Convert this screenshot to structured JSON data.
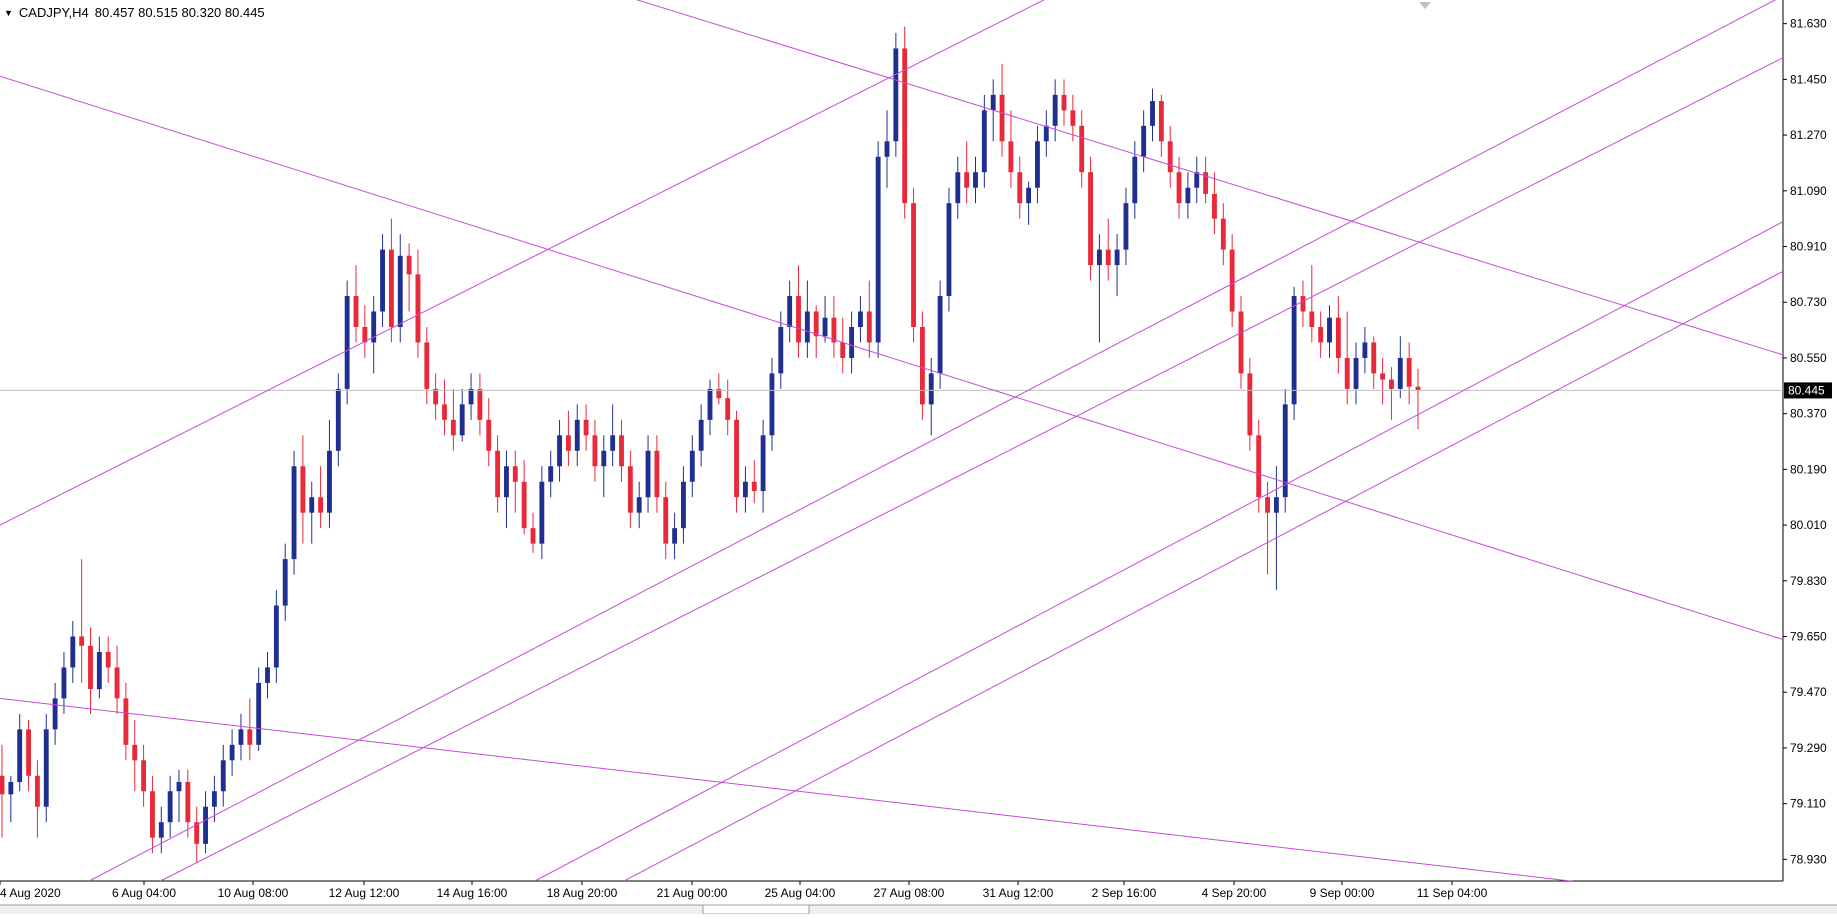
{
  "header": {
    "symbol_tf": "CADJPY,H4",
    "ohlc": "80.457 80.515 80.320 80.445"
  },
  "chart_data": {
    "type": "candlestick",
    "symbol": "CADJPY",
    "timeframe": "H4",
    "y_ticks": [
      "81.630",
      "81.450",
      "81.270",
      "81.090",
      "80.910",
      "80.730",
      "80.550",
      "80.370",
      "80.190",
      "80.010",
      "79.830",
      "79.650",
      "79.470",
      "79.290",
      "79.110",
      "78.930"
    ],
    "ylim": [
      78.86,
      81.7
    ],
    "x_ticks": [
      "4 Aug 2020",
      "6 Aug 04:00",
      "10 Aug 08:00",
      "12 Aug 12:00",
      "14 Aug 16:00",
      "18 Aug 20:00",
      "21 Aug 00:00",
      "25 Aug 04:00",
      "27 Aug 08:00",
      "31 Aug 12:00",
      "2 Sep 16:00",
      "4 Sep 20:00",
      "9 Sep 00:00",
      "11 Sep 04:00"
    ],
    "current_price": "80.445",
    "colors": {
      "bull": "#1f2f8f",
      "bear": "#e8293a",
      "trendline": "#c74bd9",
      "price_line": "#c0c0c0",
      "price_label_bg": "#000000"
    },
    "candles": [
      [
        79.2,
        79.3,
        79.0,
        79.14
      ],
      [
        79.14,
        79.2,
        79.05,
        79.18
      ],
      [
        79.18,
        79.4,
        79.15,
        79.35
      ],
      [
        79.35,
        79.38,
        79.15,
        79.2
      ],
      [
        79.2,
        79.25,
        79.0,
        79.1
      ],
      [
        79.1,
        79.4,
        79.05,
        79.35
      ],
      [
        79.35,
        79.5,
        79.3,
        79.45
      ],
      [
        79.45,
        79.6,
        79.4,
        79.55
      ],
      [
        79.55,
        79.7,
        79.5,
        79.65
      ],
      [
        79.65,
        79.9,
        79.5,
        79.62
      ],
      [
        79.62,
        79.68,
        79.4,
        79.48
      ],
      [
        79.48,
        79.65,
        79.45,
        79.6
      ],
      [
        79.6,
        79.65,
        79.5,
        79.55
      ],
      [
        79.55,
        79.62,
        79.4,
        79.45
      ],
      [
        79.45,
        79.5,
        79.25,
        79.3
      ],
      [
        79.3,
        79.38,
        79.15,
        79.25
      ],
      [
        79.25,
        79.3,
        79.1,
        79.15
      ],
      [
        79.15,
        79.2,
        78.95,
        79.0
      ],
      [
        79.0,
        79.1,
        78.95,
        79.05
      ],
      [
        79.05,
        79.2,
        79.0,
        79.15
      ],
      [
        79.15,
        79.22,
        79.05,
        79.18
      ],
      [
        79.18,
        79.22,
        79.0,
        79.05
      ],
      [
        79.05,
        79.1,
        78.92,
        78.98
      ],
      [
        78.98,
        79.15,
        78.95,
        79.1
      ],
      [
        79.1,
        79.2,
        79.05,
        79.15
      ],
      [
        79.15,
        79.3,
        79.1,
        79.25
      ],
      [
        79.25,
        79.35,
        79.2,
        79.3
      ],
      [
        79.3,
        79.4,
        79.25,
        79.35
      ],
      [
        79.35,
        79.45,
        79.25,
        79.3
      ],
      [
        79.3,
        79.55,
        79.28,
        79.5
      ],
      [
        79.5,
        79.6,
        79.45,
        79.55
      ],
      [
        79.55,
        79.8,
        79.5,
        79.75
      ],
      [
        79.75,
        79.95,
        79.7,
        79.9
      ],
      [
        79.9,
        80.25,
        79.85,
        80.2
      ],
      [
        80.2,
        80.3,
        79.95,
        80.05
      ],
      [
        80.05,
        80.15,
        79.95,
        80.1
      ],
      [
        80.1,
        80.2,
        80.0,
        80.05
      ],
      [
        80.05,
        80.35,
        80.0,
        80.25
      ],
      [
        80.25,
        80.5,
        80.2,
        80.45
      ],
      [
        80.45,
        80.8,
        80.4,
        80.75
      ],
      [
        80.75,
        80.85,
        80.6,
        80.65
      ],
      [
        80.65,
        80.72,
        80.55,
        80.6
      ],
      [
        80.6,
        80.75,
        80.5,
        80.7
      ],
      [
        80.7,
        80.95,
        80.65,
        80.9
      ],
      [
        80.9,
        81.0,
        80.6,
        80.65
      ],
      [
        80.65,
        80.95,
        80.6,
        80.88
      ],
      [
        80.88,
        80.92,
        80.7,
        80.82
      ],
      [
        80.82,
        80.9,
        80.55,
        80.6
      ],
      [
        80.6,
        80.65,
        80.4,
        80.45
      ],
      [
        80.45,
        80.5,
        80.35,
        80.4
      ],
      [
        80.4,
        80.48,
        80.3,
        80.35
      ],
      [
        80.35,
        80.45,
        80.25,
        80.3
      ],
      [
        80.3,
        80.45,
        80.28,
        80.4
      ],
      [
        80.4,
        80.5,
        80.35,
        80.45
      ],
      [
        80.45,
        80.5,
        80.3,
        80.35
      ],
      [
        80.35,
        80.42,
        80.2,
        80.25
      ],
      [
        80.25,
        80.3,
        80.05,
        80.1
      ],
      [
        80.1,
        80.25,
        80.0,
        80.2
      ],
      [
        80.2,
        80.25,
        80.05,
        80.15
      ],
      [
        80.15,
        80.22,
        79.98,
        80.0
      ],
      [
        80.0,
        80.05,
        79.92,
        79.95
      ],
      [
        79.95,
        80.2,
        79.9,
        80.15
      ],
      [
        80.15,
        80.25,
        80.1,
        80.2
      ],
      [
        80.2,
        80.35,
        80.15,
        80.3
      ],
      [
        80.3,
        80.38,
        80.2,
        80.25
      ],
      [
        80.25,
        80.4,
        80.2,
        80.35
      ],
      [
        80.35,
        80.4,
        80.25,
        80.3
      ],
      [
        80.3,
        80.35,
        80.15,
        80.2
      ],
      [
        80.2,
        80.3,
        80.1,
        80.25
      ],
      [
        80.25,
        80.4,
        80.2,
        80.3
      ],
      [
        80.3,
        80.35,
        80.15,
        80.2
      ],
      [
        80.2,
        80.25,
        80.0,
        80.05
      ],
      [
        80.05,
        80.15,
        80.0,
        80.1
      ],
      [
        80.1,
        80.3,
        80.05,
        80.25
      ],
      [
        80.25,
        80.3,
        80.05,
        80.1
      ],
      [
        80.1,
        80.15,
        79.9,
        79.95
      ],
      [
        79.95,
        80.05,
        79.9,
        80.0
      ],
      [
        80.0,
        80.2,
        79.95,
        80.15
      ],
      [
        80.15,
        80.3,
        80.1,
        80.25
      ],
      [
        80.25,
        80.4,
        80.2,
        80.35
      ],
      [
        80.35,
        80.48,
        80.3,
        80.45
      ],
      [
        80.45,
        80.5,
        80.4,
        80.42
      ],
      [
        80.42,
        80.48,
        80.3,
        80.35
      ],
      [
        80.35,
        80.38,
        80.05,
        80.1
      ],
      [
        80.1,
        80.2,
        80.05,
        80.15
      ],
      [
        80.15,
        80.22,
        80.08,
        80.12
      ],
      [
        80.12,
        80.35,
        80.05,
        80.3
      ],
      [
        80.3,
        80.55,
        80.25,
        80.5
      ],
      [
        80.5,
        80.7,
        80.45,
        80.65
      ],
      [
        80.65,
        80.8,
        80.6,
        80.75
      ],
      [
        80.75,
        80.85,
        80.55,
        80.6
      ],
      [
        80.6,
        80.8,
        80.55,
        80.7
      ],
      [
        80.7,
        80.72,
        80.55,
        80.62
      ],
      [
        80.62,
        80.75,
        80.6,
        80.68
      ],
      [
        80.68,
        80.75,
        80.55,
        80.6
      ],
      [
        80.6,
        80.68,
        80.5,
        80.55
      ],
      [
        80.55,
        80.7,
        80.5,
        80.65
      ],
      [
        80.65,
        80.75,
        80.6,
        80.7
      ],
      [
        80.7,
        80.8,
        80.55,
        80.6
      ],
      [
        80.6,
        81.25,
        80.55,
        81.2
      ],
      [
        81.2,
        81.35,
        81.1,
        81.25
      ],
      [
        81.25,
        81.6,
        81.2,
        81.55
      ],
      [
        81.55,
        81.62,
        81.0,
        81.05
      ],
      [
        81.05,
        81.1,
        80.6,
        80.65
      ],
      [
        80.65,
        80.7,
        80.35,
        80.4
      ],
      [
        80.4,
        80.55,
        80.3,
        80.5
      ],
      [
        80.5,
        80.8,
        80.45,
        80.75
      ],
      [
        80.75,
        81.1,
        80.7,
        81.05
      ],
      [
        81.05,
        81.2,
        81.0,
        81.15
      ],
      [
        81.15,
        81.25,
        81.05,
        81.1
      ],
      [
        81.1,
        81.2,
        81.05,
        81.15
      ],
      [
        81.15,
        81.4,
        81.1,
        81.35
      ],
      [
        81.35,
        81.45,
        81.25,
        81.4
      ],
      [
        81.4,
        81.5,
        81.2,
        81.25
      ],
      [
        81.25,
        81.35,
        81.1,
        81.15
      ],
      [
        81.15,
        81.2,
        81.0,
        81.05
      ],
      [
        81.05,
        81.12,
        80.98,
        81.1
      ],
      [
        81.1,
        81.3,
        81.05,
        81.25
      ],
      [
        81.25,
        81.35,
        81.2,
        81.3
      ],
      [
        81.3,
        81.45,
        81.25,
        81.4
      ],
      [
        81.4,
        81.45,
        81.3,
        81.35
      ],
      [
        81.35,
        81.4,
        81.25,
        81.3
      ],
      [
        81.3,
        81.35,
        81.1,
        81.15
      ],
      [
        81.15,
        81.2,
        80.8,
        80.85
      ],
      [
        80.85,
        80.95,
        80.6,
        80.9
      ],
      [
        80.9,
        81.0,
        80.8,
        80.85
      ],
      [
        80.85,
        80.95,
        80.75,
        80.9
      ],
      [
        80.9,
        81.1,
        80.85,
        81.05
      ],
      [
        81.05,
        81.25,
        81.0,
        81.2
      ],
      [
        81.2,
        81.35,
        81.15,
        81.3
      ],
      [
        81.3,
        81.42,
        81.25,
        81.38
      ],
      [
        81.38,
        81.4,
        81.2,
        81.25
      ],
      [
        81.25,
        81.3,
        81.1,
        81.15
      ],
      [
        81.15,
        81.2,
        81.0,
        81.05
      ],
      [
        81.05,
        81.15,
        81.0,
        81.1
      ],
      [
        81.1,
        81.2,
        81.05,
        81.15
      ],
      [
        81.15,
        81.2,
        81.05,
        81.08
      ],
      [
        81.08,
        81.15,
        80.95,
        81.0
      ],
      [
        81.0,
        81.05,
        80.85,
        80.9
      ],
      [
        80.9,
        80.95,
        80.65,
        80.7
      ],
      [
        80.7,
        80.75,
        80.45,
        80.5
      ],
      [
        80.5,
        80.55,
        80.25,
        80.3
      ],
      [
        80.3,
        80.35,
        80.05,
        80.1
      ],
      [
        80.1,
        80.15,
        79.85,
        80.05
      ],
      [
        80.05,
        80.2,
        79.8,
        80.1
      ],
      [
        80.1,
        80.45,
        80.05,
        80.4
      ],
      [
        80.4,
        80.78,
        80.35,
        80.75
      ],
      [
        80.75,
        80.8,
        80.65,
        80.7
      ],
      [
        80.7,
        80.85,
        80.6,
        80.65
      ],
      [
        80.65,
        80.7,
        80.55,
        80.6
      ],
      [
        80.6,
        80.72,
        80.55,
        80.68
      ],
      [
        80.68,
        80.75,
        80.5,
        80.55
      ],
      [
        80.55,
        80.7,
        80.4,
        80.45
      ],
      [
        80.45,
        80.6,
        80.4,
        80.55
      ],
      [
        80.55,
        80.65,
        80.5,
        80.6
      ],
      [
        80.6,
        80.62,
        80.45,
        80.5
      ],
      [
        80.5,
        80.55,
        80.4,
        80.48
      ],
      [
        80.48,
        80.52,
        80.35,
        80.45
      ],
      [
        80.45,
        80.62,
        80.42,
        80.55
      ],
      [
        80.55,
        80.6,
        80.4,
        80.457
      ],
      [
        80.457,
        80.515,
        80.32,
        80.445
      ]
    ],
    "trendlines": [
      {
        "from": [
          0,
          79.45
        ],
        "to": [
          1.0,
          78.78
        ]
      },
      {
        "from": [
          0,
          81.46
        ],
        "to": [
          1.0,
          79.64
        ]
      },
      {
        "from": [
          0.35,
          81.72
        ],
        "to": [
          1.0,
          80.56
        ]
      },
      {
        "from": [
          0,
          80.01
        ],
        "to": [
          0.59,
          81.72
        ]
      },
      {
        "from": [
          0.05,
          78.86
        ],
        "to": [
          1.0,
          81.72
        ]
      },
      {
        "from": [
          0.09,
          78.86
        ],
        "to": [
          1.0,
          81.52
        ]
      },
      {
        "from": [
          0.3,
          78.86
        ],
        "to": [
          1.0,
          80.99
        ]
      },
      {
        "from": [
          0.35,
          78.86
        ],
        "to": [
          1.0,
          80.83
        ]
      }
    ]
  }
}
